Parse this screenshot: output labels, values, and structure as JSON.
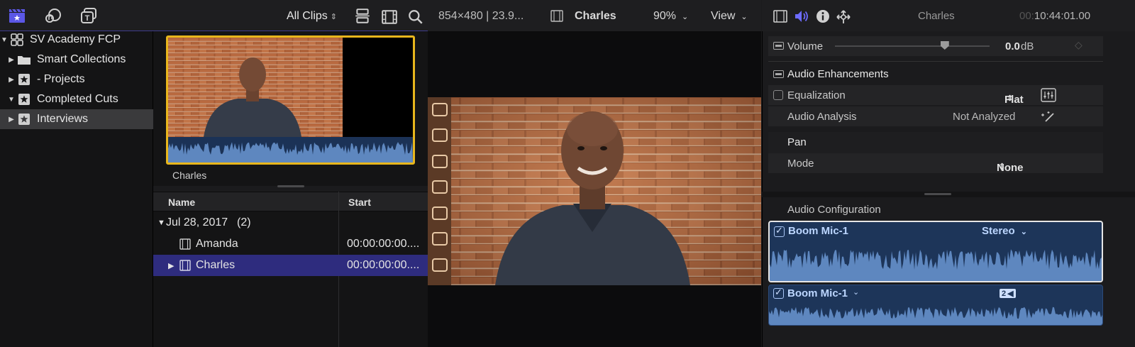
{
  "browser": {
    "toolbar": {
      "filter_label": "All Clips",
      "icons": [
        "clapper-libraries-icon",
        "photos-audio-icon",
        "titles-generators-icon",
        "filmstrip-view-icon",
        "list-view-icon",
        "search-icon"
      ]
    },
    "library": {
      "name": "SV Academy FCP",
      "items": [
        {
          "label": "Smart Collections",
          "icon": "folder-icon",
          "disclosure": "▶"
        },
        {
          "label": "- Projects",
          "icon": "event-star-icon",
          "disclosure": "▶"
        },
        {
          "label": "Completed Cuts",
          "icon": "event-star-icon",
          "disclosure": "▼"
        },
        {
          "label": "Interviews",
          "icon": "event-star-icon",
          "disclosure": "▶",
          "selected": true
        }
      ]
    },
    "filmstrip": {
      "clip_name": "Charles"
    },
    "list": {
      "columns": [
        "Name",
        "Start"
      ],
      "group": {
        "label": "Jul 28, 2017",
        "count": "(2)"
      },
      "rows": [
        {
          "name": "Amanda",
          "start": "00:00:00:00...."
        },
        {
          "name": "Charles",
          "start": "00:00:00:00....",
          "selected": true
        }
      ]
    }
  },
  "viewer": {
    "format": "854×480 | 23.9...",
    "clip_name": "Charles",
    "zoom": "90%",
    "view_label": "View"
  },
  "inspector": {
    "tabs": [
      "video-inspector-icon",
      "audio-inspector-icon",
      "info-inspector-icon",
      "share-inspector-icon"
    ],
    "clip_name": "Charles",
    "timecode_dim": "00:",
    "timecode": "10:44:01.00",
    "volume": {
      "label": "Volume",
      "value": "0.0",
      "unit": "dB",
      "level": 0.71
    },
    "enhancements": {
      "title": "Audio Enhancements",
      "equalization_label": "Equalization",
      "equalization_value": "Flat",
      "analysis_label": "Audio Analysis",
      "analysis_value": "Not Analyzed"
    },
    "pan": {
      "title": "Pan",
      "mode_label": "Mode",
      "mode_value": "None"
    },
    "audio_config": {
      "title": "Audio Configuration",
      "component_1": {
        "label": "Boom Mic-1",
        "channel": "Stereo"
      },
      "component_2": {
        "label": "Boom Mic-1",
        "badge": "2"
      }
    }
  },
  "colors": {
    "accent": "#3e3b8a",
    "selection": "#2e2c7e",
    "clip_border": "#e8b61c",
    "audio_bg": "#1d3559",
    "waveform": "#5e87bf"
  }
}
